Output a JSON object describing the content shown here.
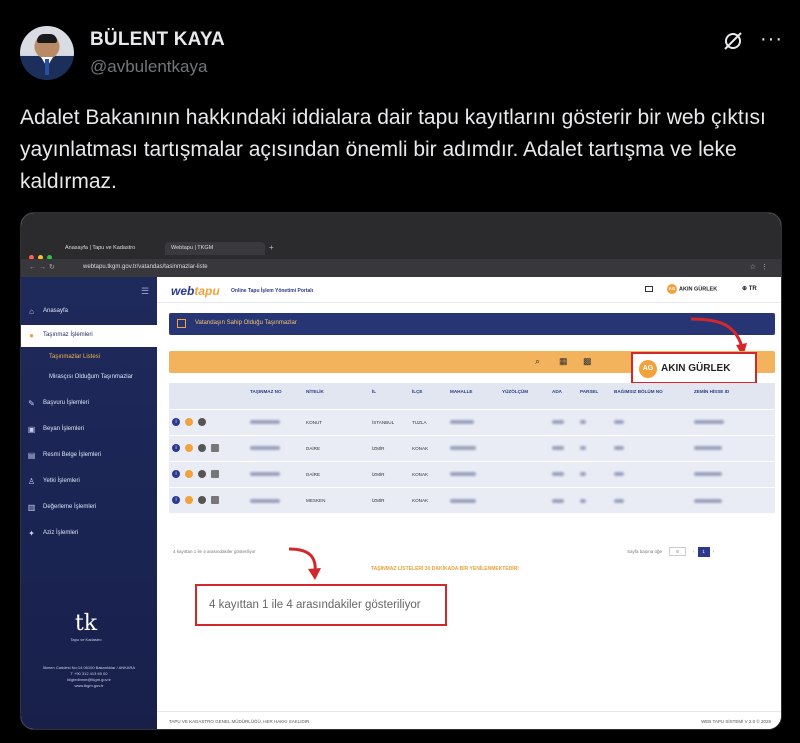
{
  "tweet": {
    "author_name": "BÜLENT KAYA",
    "author_handle": "@avbulentkaya",
    "text": "Adalet Bakanının hakkındaki iddialara dair tapu kayıtlarını gösterir bir web çıktısı yayınlatması tartışmalar açısından önemli bir adımdır. Adalet tartışma ve leke kaldırmaz.",
    "more": "···"
  },
  "browser": {
    "tab1": "Anasayfa | Tapu ve Kadastro",
    "tab2": "Webtapu | TKGM",
    "url": "webtapu.tkgm.gov.tr/vatandas/tasinmazlar-liste"
  },
  "sidebar": {
    "items": [
      {
        "label": "Anasayfa"
      },
      {
        "label": "Taşınmaz İşlemleri"
      },
      {
        "label": "Taşınmazlar Listesi"
      },
      {
        "label": "Mirasçısı Olduğum Taşınmazlar"
      },
      {
        "label": "Başvuru İşlemleri"
      },
      {
        "label": "Beyan İşlemleri"
      },
      {
        "label": "Resmi Belge İşlemleri"
      },
      {
        "label": "Yetki İşlemleri"
      },
      {
        "label": "Değerleme İşlemleri"
      },
      {
        "label": "Aziz İşlemleri"
      }
    ],
    "logo_caption": "Tapu ve Kadastro",
    "address_1": "İlkmen Caddesi No:14 06100 Bakanlıklar / ANKARA",
    "address_2": "T +90 312 413 60 00",
    "address_3": "bilgiedinme@tkgm.gov.tr",
    "address_4": "www.tkgm.gov.tr"
  },
  "portal": {
    "logo_a": "web",
    "logo_b": "tapu",
    "title": "Online Tapu İşlem Yönetimi Portalı",
    "user": "AKIN GÜRLEK",
    "user_initials": "AG",
    "lang": "TR",
    "panel_title": "Vatandaşın Sahip Olduğu Taşınmazlar"
  },
  "table": {
    "headers": [
      "TAŞINMAZ NO",
      "NİTELİK",
      "İL",
      "İLÇE",
      "MAHALLE",
      "YÜZÖLÇÜM",
      "ADA",
      "PARSEL",
      "BAĞIMSIZ BÖLÜM NO",
      "ZEMİN HİSSE ID"
    ],
    "rows": [
      {
        "nitelik": "KONUT",
        "il": "İSTANBUL",
        "ilce": "TUZLA"
      },
      {
        "nitelik": "DAİRE",
        "il": "İZMİR",
        "ilce": "KONAK"
      },
      {
        "nitelik": "DAİRE",
        "il": "İZMİR",
        "ilce": "KONAK"
      },
      {
        "nitelik": "MESKEN",
        "il": "İZMİR",
        "ilce": "KONAK"
      }
    ]
  },
  "footer": {
    "info": "4 kayıttan 1 ile 4 arasındakiler gösteriliyor",
    "page_size_label": "Sayfa başına öğe",
    "page_size": "8",
    "current_page": "1",
    "warning": "TAŞINMAZ LİSTELERİ 30 DAKİKADA BİR YENİLENMEKTEDİR!",
    "callout": "4 kayıttan 1 ile 4 arasındakiler gösteriliyor",
    "copyright": "TAPU VE KADASTRO GENEL MÜDÜRLÜĞÜ, HER HAKKI SAKLIDIR.",
    "version": "WEB TAPU SİSTEMİ V 2.0 © 2026"
  },
  "colors": {
    "sidebar": "#1f2a5c",
    "accent": "#f1a23a",
    "callout_border": "#d3282b"
  }
}
